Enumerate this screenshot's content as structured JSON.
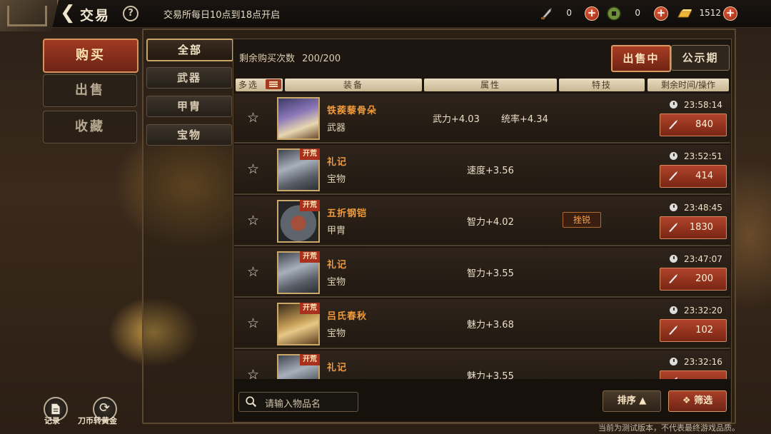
{
  "header": {
    "title": "交易",
    "help": "?",
    "notice": "交易所每日10点到18点开启",
    "currencies": [
      {
        "icon": "knife-coin-icon",
        "value": "0"
      },
      {
        "icon": "jade-coin-icon",
        "value": "0"
      },
      {
        "icon": "gold-bar-icon",
        "value": "1512"
      }
    ]
  },
  "sidebar": {
    "items": [
      {
        "label": "购买",
        "active": true
      },
      {
        "label": "出售",
        "active": false
      },
      {
        "label": "收藏",
        "active": false
      }
    ]
  },
  "categories": {
    "items": [
      {
        "label": "全部",
        "active": true
      },
      {
        "label": "武器",
        "active": false
      },
      {
        "label": "甲胄",
        "active": false
      },
      {
        "label": "宝物",
        "active": false
      }
    ]
  },
  "market": {
    "remaining_label": "剩余购买次数",
    "remaining_value": "200/200",
    "tabs": [
      {
        "label": "出售中",
        "active": true
      },
      {
        "label": "公示期",
        "active": false
      }
    ],
    "columns": {
      "select": "多选",
      "equipment": "装备",
      "attributes": "属性",
      "skill": "特技",
      "time_action": "剩余时间/操作"
    },
    "rows": [
      {
        "name": "铁蒺藜骨朵",
        "type": "武器",
        "attrs": [
          "武力+4.03",
          "统率+4.34"
        ],
        "skill": "",
        "tag": "",
        "time": "23:58:14",
        "price": "840",
        "thumb": "weapon"
      },
      {
        "name": "礼记",
        "type": "宝物",
        "attrs": [
          "速度+3.56"
        ],
        "skill": "",
        "tag": "开荒",
        "time": "23:52:51",
        "price": "414",
        "thumb": "rite"
      },
      {
        "name": "五折钢铠",
        "type": "甲胄",
        "attrs": [
          "智力+4.02"
        ],
        "skill": "挫锐",
        "tag": "开荒",
        "time": "23:48:45",
        "price": "1830",
        "thumb": "armor"
      },
      {
        "name": "礼记",
        "type": "宝物",
        "attrs": [
          "智力+3.55"
        ],
        "skill": "",
        "tag": "开荒",
        "time": "23:47:07",
        "price": "200",
        "thumb": "rite"
      },
      {
        "name": "吕氏春秋",
        "type": "宝物",
        "attrs": [
          "魅力+3.68"
        ],
        "skill": "",
        "tag": "开荒",
        "time": "23:32:20",
        "price": "102",
        "thumb": "book"
      },
      {
        "name": "礼记",
        "type": "",
        "attrs": [
          "魅力+3.55"
        ],
        "skill": "",
        "tag": "开荒",
        "time": "23:32:16",
        "price": "",
        "thumb": "rite"
      }
    ],
    "search_placeholder": "请输入物品名",
    "sort_label": "排序 ▲",
    "filter_label": "筛选"
  },
  "bottom_left": {
    "records_label": "记录",
    "convert_label": "刀币转黄金"
  },
  "footnote": "当前为测试版本，不代表最终游戏品质。",
  "colors": {
    "accent_red": "#a83c24",
    "item_name_orange": "#f09a3a",
    "gold_border": "#c9a86a"
  }
}
